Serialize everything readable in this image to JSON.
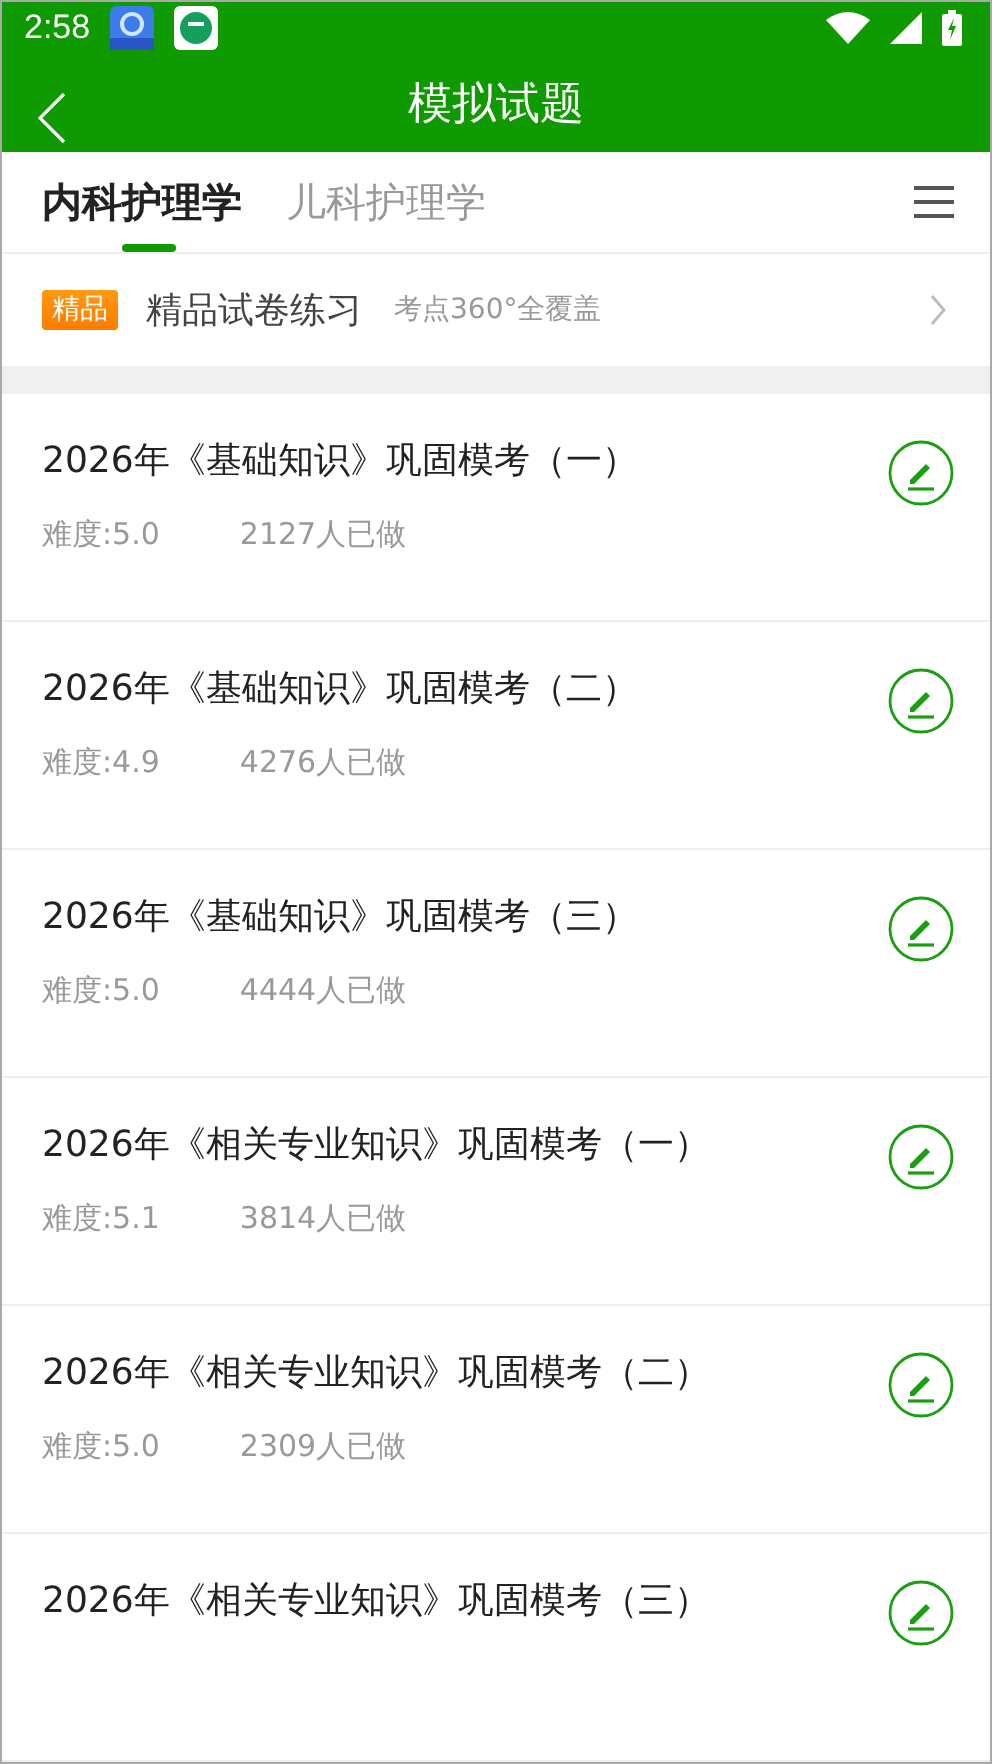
{
  "status_bar": {
    "time": "2:58"
  },
  "header": {
    "title": "模拟试题"
  },
  "tabs": [
    {
      "label": "内科护理学",
      "selected": true
    },
    {
      "label": "儿科护理学",
      "selected": false
    }
  ],
  "banner": {
    "badge": "精品",
    "title": "精品试卷练习",
    "subtitle": "考点360°全覆盖"
  },
  "papers": [
    {
      "title": "2026年《基础知识》巩固模考（一）",
      "difficulty": "难度:5.0",
      "done_count": "2127人已做"
    },
    {
      "title": "2026年《基础知识》巩固模考（二）",
      "difficulty": "难度:4.9",
      "done_count": "4276人已做"
    },
    {
      "title": "2026年《基础知识》巩固模考（三）",
      "difficulty": "难度:5.0",
      "done_count": "4444人已做"
    },
    {
      "title": "2026年《相关专业知识》巩固模考（一）",
      "difficulty": "难度:5.1",
      "done_count": "3814人已做"
    },
    {
      "title": "2026年《相关专业知识》巩固模考（二）",
      "difficulty": "难度:5.0",
      "done_count": "2309人已做"
    },
    {
      "title": "2026年《相关专业知识》巩固模考（三）"
    }
  ]
}
